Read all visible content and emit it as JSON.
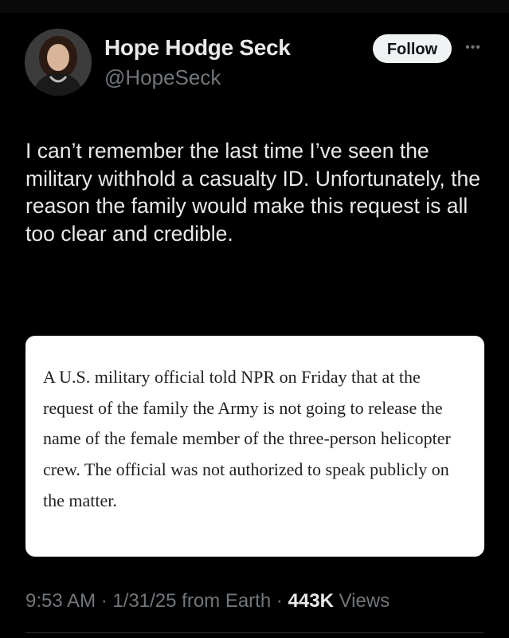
{
  "author": {
    "display_name": "Hope Hodge Seck",
    "handle": "@HopeSeck"
  },
  "actions": {
    "follow_label": "Follow",
    "more_icon": "more-horizontal-icon"
  },
  "tweet": {
    "text": "I can’t remember the last time I’ve seen the military withhold a casualty ID. Unfortunately, the reason the family would make this request is all too clear and credible."
  },
  "quote_image": {
    "text": "A U.S. military official told NPR on Friday that at the request of the family the Army is not going to release the name of the female member of the three-person helicopter crew. The official was not authorized to speak publicly on the matter."
  },
  "meta": {
    "time": "9:53 AM",
    "separator": "·",
    "date": "1/31/25",
    "source": "from Earth",
    "views_count": "443K",
    "views_label": "Views"
  },
  "colors": {
    "background": "#000000",
    "primary_text": "#e7e9ea",
    "secondary_text": "#71767b",
    "follow_button_bg": "#eff3f4",
    "card_bg": "#ffffff"
  }
}
